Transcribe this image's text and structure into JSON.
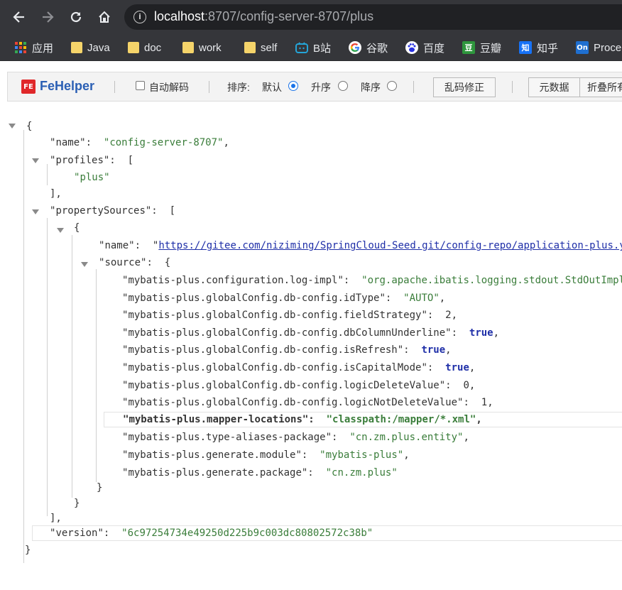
{
  "browser": {
    "url_host": "localhost",
    "url_path": ":8707/config-server-8707/plus",
    "back_icon": "arrow-left",
    "forward_icon": "arrow-right",
    "reload_icon": "reload",
    "home_icon": "home"
  },
  "bookmarks": [
    {
      "label": "应用",
      "icon": "apps-grid"
    },
    {
      "label": "Java",
      "icon": "folder"
    },
    {
      "label": "doc",
      "icon": "folder"
    },
    {
      "label": "work",
      "icon": "folder"
    },
    {
      "label": "self",
      "icon": "folder"
    },
    {
      "label": "B站",
      "icon": "bilibili"
    },
    {
      "label": "谷歌",
      "icon": "google"
    },
    {
      "label": "百度",
      "icon": "baidu"
    },
    {
      "label": "豆瓣",
      "icon": "douban",
      "glyph": "豆"
    },
    {
      "label": "知乎",
      "icon": "zhihu",
      "glyph": "知"
    },
    {
      "label": "Proce",
      "icon": "processon",
      "glyph": "On"
    }
  ],
  "fehelper": {
    "logo": "FE",
    "name": "FeHelper",
    "auto_decode": "自动解码",
    "sort_label": "排序:",
    "sort_default": "默认",
    "sort_asc": "升序",
    "sort_desc": "降序",
    "fix_garbled": "乱码修正",
    "metadata": "元数据",
    "fold_all": "折叠所有"
  },
  "json": {
    "name_key": "name",
    "name_value": "config-server-8707",
    "profiles_key": "profiles",
    "profiles": [
      "plus"
    ],
    "property_sources_key": "propertySources",
    "ps_name_value": "https://gitee.com/niziming/SpringCloud-Seed.git/config-repo/application-plus.yml",
    "source_key": "source",
    "source": [
      {
        "key": "mybatis-plus.configuration.log-impl",
        "value": "org.apache.ibatis.logging.stdout.StdOutImpl",
        "type": "string"
      },
      {
        "key": "mybatis-plus.globalConfig.db-config.idType",
        "value": "AUTO",
        "type": "string"
      },
      {
        "key": "mybatis-plus.globalConfig.db-config.fieldStrategy",
        "value": "2",
        "type": "number"
      },
      {
        "key": "mybatis-plus.globalConfig.db-config.dbColumnUnderline",
        "value": "true",
        "type": "bool"
      },
      {
        "key": "mybatis-plus.globalConfig.db-config.isRefresh",
        "value": "true",
        "type": "bool"
      },
      {
        "key": "mybatis-plus.globalConfig.db-config.isCapitalMode",
        "value": "true",
        "type": "bool"
      },
      {
        "key": "mybatis-plus.globalConfig.db-config.logicDeleteValue",
        "value": "0",
        "type": "number"
      },
      {
        "key": "mybatis-plus.globalConfig.db-config.logicNotDeleteValue",
        "value": "1",
        "type": "number"
      },
      {
        "key": "mybatis-plus.mapper-locations",
        "value": "classpath:/mapper/*.xml",
        "type": "string",
        "selected": true
      },
      {
        "key": "mybatis-plus.type-aliases-package",
        "value": "cn.zm.plus.entity",
        "type": "string"
      },
      {
        "key": "mybatis-plus.generate.module",
        "value": "mybatis-plus",
        "type": "string"
      },
      {
        "key": "mybatis-plus.generate.package",
        "value": "cn.zm.plus",
        "type": "string"
      }
    ],
    "version_key": "version",
    "version_value": "6c97254734e49250d225b9c003dc80802572c38b"
  },
  "colors": {
    "chrome_bar": "#35363a",
    "string_value": "#3a7d3a",
    "bool_value": "#1f2fa8",
    "fehelper_brand": "#2b5fb4"
  }
}
